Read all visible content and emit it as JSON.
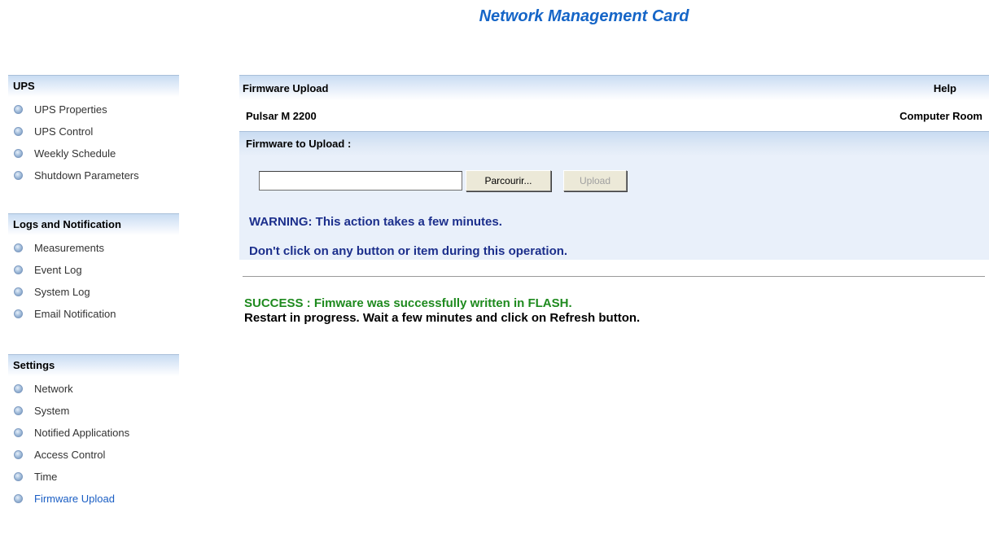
{
  "page_title": "Network Management Card",
  "sidebar": {
    "sections": [
      {
        "header": "UPS",
        "items": [
          "UPS Properties",
          "UPS Control",
          "Weekly Schedule",
          "Shutdown Parameters"
        ]
      },
      {
        "header": "Logs and Notification",
        "items": [
          "Measurements",
          "Event Log",
          "System Log",
          "Email Notification"
        ]
      },
      {
        "header": "Settings",
        "items": [
          "Network",
          "System",
          "Notified Applications",
          "Access Control",
          "Time",
          "Firmware Upload"
        ]
      }
    ],
    "active_item": "Firmware Upload"
  },
  "main": {
    "header_title": "Firmware Upload",
    "help_label": "Help",
    "device_name": "Pulsar M 2200",
    "location": "Computer Room",
    "section_title": "Firmware to Upload :",
    "file_value": "",
    "browse_label": "Parcourir...",
    "upload_label": "Upload",
    "warning_line1": "WARNING: This action takes a few minutes.",
    "warning_line2": "Don't click on any button or item during this operation.",
    "success_message": "SUCCESS : Fimware was successfully written in FLASH.",
    "restart_message": "Restart in progress. Wait a few minutes and click on Refresh button."
  }
}
